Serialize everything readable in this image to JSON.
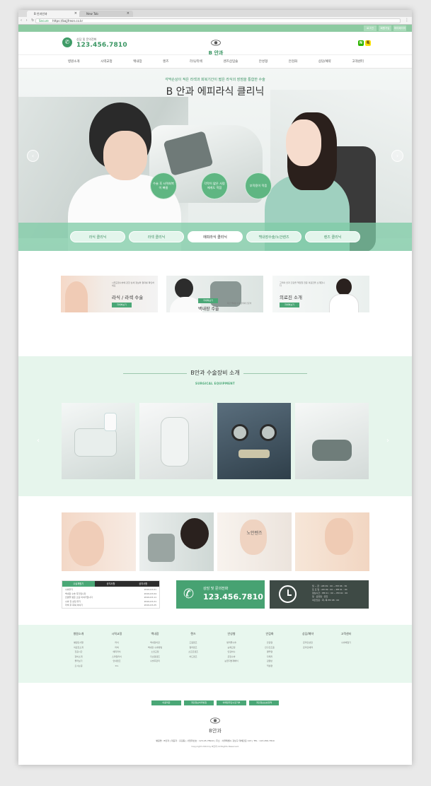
{
  "browser": {
    "tab_active": "B 안과안과",
    "tab_other": "New Tab",
    "secure_label": "Secure",
    "url": "https://bajjfreon.co.kr"
  },
  "topbar": {
    "links": [
      "로그인",
      "회원가입",
      "마이페이지"
    ]
  },
  "header": {
    "phone_label": "상담 및 문의전화",
    "phone_number": "123.456.7810",
    "logo_text": "B 안과",
    "sns": [
      "N",
      "톡"
    ]
  },
  "nav": [
    "병원소개",
    "시력교정",
    "백내장",
    "렌즈",
    "라식/라섹",
    "렌즈삽입술",
    "안성형",
    "안검화",
    "상담/예약",
    "고객센터"
  ],
  "hero": {
    "subtitle": "각막손상이 적은 라섹과 회복기간이 짧은 라식의 장점을 통합한 수술",
    "title": "B 안과 에피라식 클리닉",
    "bubbles": [
      "수술 후 시력회복이 빠름",
      "각막이 얇은 사람에게도 적합",
      "부작용이 적음"
    ],
    "tabs": [
      "라식 클리닉",
      "라섹 클리닉",
      "에피라식 클리닉",
      "백내장수술/노안렌즈",
      "렌즈 클리닉"
    ],
    "active_tab": 2
  },
  "cards": [
    {
      "caption": "시력교정수술에 관한 상세 정보와 결과를 확인하세요",
      "title": "라식 / 라섹 수술",
      "button": "자세히보기"
    },
    {
      "caption": "최신 백내장 수술 장비와 전문의",
      "title": "백내장 수술",
      "button": "자세히보기"
    },
    {
      "caption": "고객의 안과 건강을 책임질 전문 의료진을 소개합니다",
      "title": "의료진 소개",
      "button": "자세히보기"
    }
  ],
  "equipment": {
    "title": "B안과 수술장비 소개",
    "subtitle": "SURGICAL EQUIPMENT"
  },
  "thumbs": {
    "lens_label": "노안렌즈"
  },
  "board": {
    "tabs": [
      "수술체험기",
      "공지사항",
      "공지사항"
    ],
    "rows": [
      {
        "t": "수술후기",
        "d": "2019-03-01"
      },
      {
        "t": "백내장 수술 후기입니다",
        "d": "2019-03-04"
      },
      {
        "t": "안경을 벗은 소감 이야기입니다",
        "d": "2019-03-11"
      },
      {
        "t": "수술 전 상담 후기",
        "d": "2019-03-21"
      },
      {
        "t": "라섹 후 회복 이야기",
        "d": "2019-03-25"
      }
    ]
  },
  "call": {
    "label": "상담 및 문의전화",
    "number": "123.456.7810"
  },
  "hours": {
    "rows": [
      "월 ~ 금 : AM 09 : 00 ~ PM 06 : 30",
      "토 요 일 : AM 09 : 00 ~ PM 01 : 00",
      "점심시간 : PM 01 : 00 ~ PM 02 : 00",
      "일 · 공휴일 : 휴진",
      "야간진료 : 화, 목 PM 08 : 00"
    ]
  },
  "sitemap": [
    {
      "h": "병원소개",
      "items": [
        "병원인사말",
        "의료진소개",
        "진료시간",
        "장비소개",
        "둘러보기",
        "오시는길"
      ]
    },
    {
      "h": "시력교정",
      "items": [
        "라식",
        "라섹",
        "에피라식",
        "스마일라식",
        "안내렌즈",
        "ICL"
      ]
    },
    {
      "h": "백내장",
      "items": [
        "백내장이란",
        "백내장 수술방법",
        "노안교정",
        "다초점렌즈",
        "수술후관리"
      ]
    },
    {
      "h": "렌즈",
      "items": [
        "드림렌즈",
        "컬러렌즈",
        "소프트렌즈",
        "하드렌즈"
      ]
    },
    {
      "h": "안성형",
      "items": [
        "쌍꺼풀수술",
        "눈매교정",
        "안검하수",
        "트임수술",
        "눈밑지방재배치"
      ]
    },
    {
      "h": "안검화",
      "items": [
        "안검염",
        "안구건조증",
        "결막염",
        "다래끼",
        "검열반",
        "익상편"
      ]
    },
    {
      "h": "상담/예약",
      "items": [
        "온라인상담",
        "온라인예약"
      ]
    },
    {
      "h": "고객센터",
      "items": [
        "수술체험기"
      ]
    }
  ],
  "footer": {
    "buttons": [
      "이용약관",
      "개인정보처리방침",
      "이메일무단수집거부",
      "개인정보보호정책"
    ],
    "logo_text": "B안과",
    "info": "병원명 : B안과   |   대표자 : 홍길동   |   사업자번호 : 123-45-78910   |   주소 : 서울특별시 강남구 테헤란로 123   |   TEL : 123-456-7810",
    "copyright": "Copyright 2019 by B안과 All Rights Reserved."
  },
  "colors": {
    "brand_green": "#4aa776",
    "mint_bg": "#e6f5ec",
    "topbar": "#8ccaa1",
    "dark": "#3e4a45"
  }
}
